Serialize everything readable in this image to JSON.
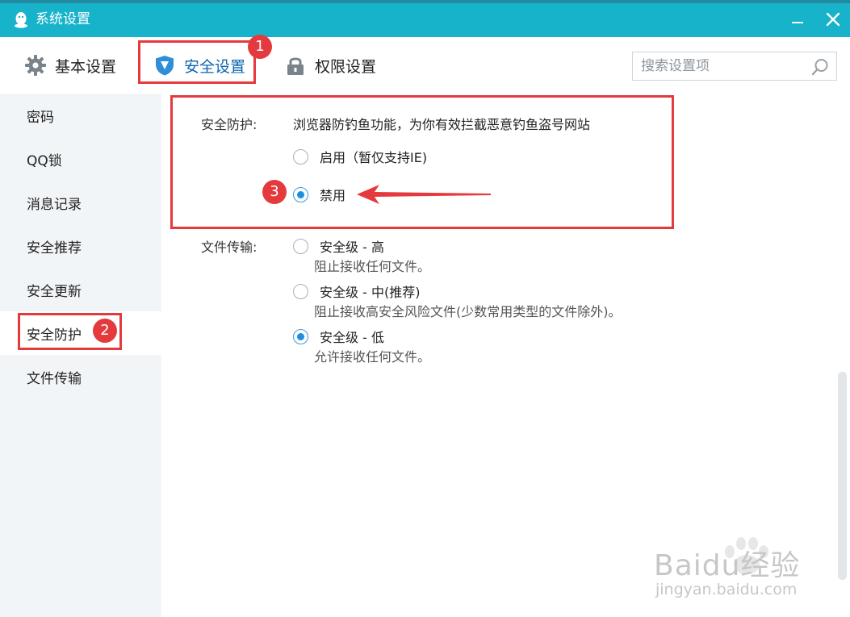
{
  "window": {
    "title": "系统设置",
    "app_icon": "qq-penguin-icon",
    "minimize_icon": "minimize-icon",
    "close_icon": "close-icon",
    "title_bar_color": "#17b3cb"
  },
  "tabs": [
    {
      "label": "基本设置",
      "icon": "gear-icon",
      "active": false
    },
    {
      "label": "安全设置",
      "icon": "shield-icon",
      "active": true
    },
    {
      "label": "权限设置",
      "icon": "lock-icon",
      "active": false
    }
  ],
  "search": {
    "placeholder": "搜索设置项",
    "value": "",
    "icon": "search-icon"
  },
  "sidebar": {
    "items": [
      {
        "label": "密码"
      },
      {
        "label": "QQ锁"
      },
      {
        "label": "消息记录"
      },
      {
        "label": "安全推荐"
      },
      {
        "label": "安全更新"
      },
      {
        "label": "安全防护",
        "active": true
      },
      {
        "label": "文件传输"
      }
    ]
  },
  "security_protection": {
    "label": "安全防护:",
    "description": "浏览器防钓鱼功能，为你有效拦截恶意钓鱼盗号网站",
    "options": [
      {
        "label": "启用（暂仅支持IE)",
        "checked": false
      },
      {
        "label": "禁用",
        "checked": true
      }
    ]
  },
  "file_transfer": {
    "label": "文件传输:",
    "options": [
      {
        "label": "安全级 - 高",
        "note": "阻止接收任何文件。",
        "checked": false
      },
      {
        "label": "安全级 - 中(推荐)",
        "note": "阻止接收高安全风险文件(少数常用类型的文件除外)。",
        "checked": false
      },
      {
        "label": "安全级 - 低",
        "note": "允许接收任何文件。",
        "checked": true
      }
    ]
  },
  "annotations": {
    "badges": [
      "1",
      "2",
      "3"
    ],
    "color": "#e53a3d"
  },
  "watermark": {
    "logo": "Baidu经验",
    "url": "jingyan.baidu.com"
  }
}
